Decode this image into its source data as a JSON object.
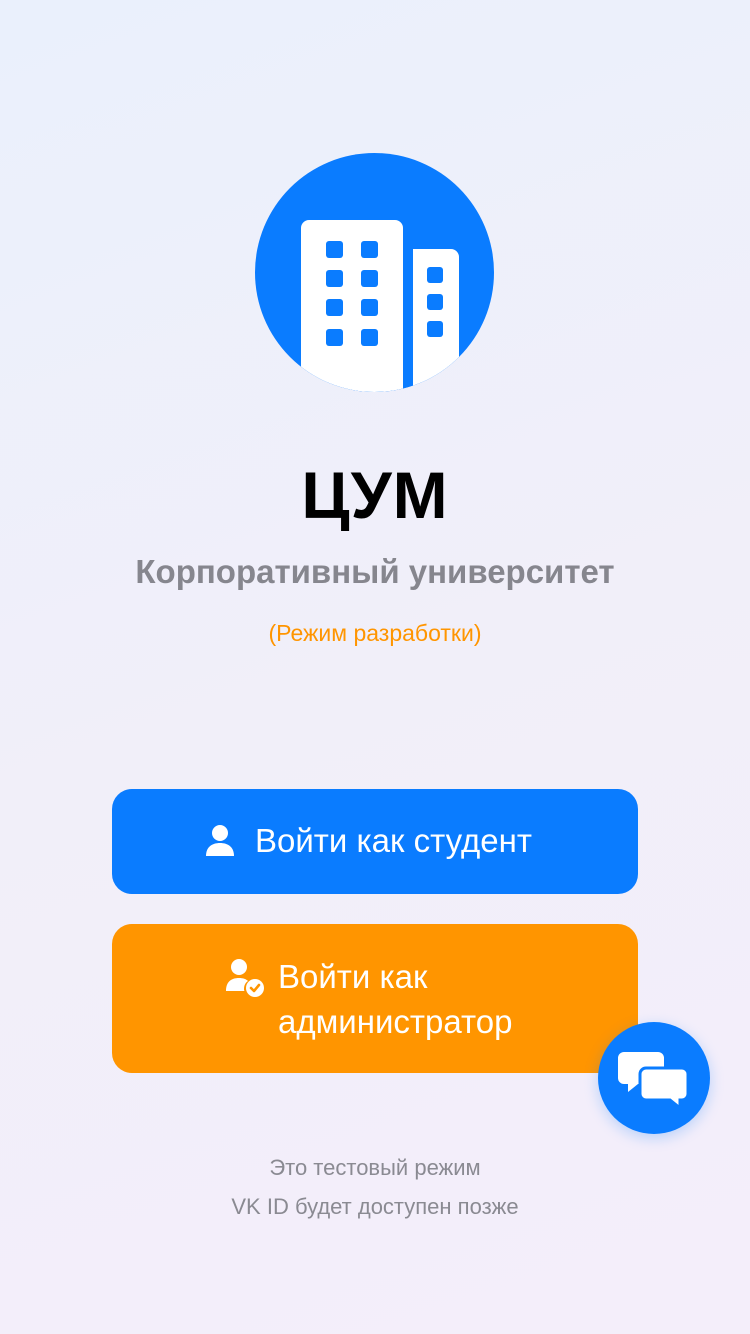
{
  "app": {
    "title": "ЦУМ",
    "subtitle": "Корпоративный университет",
    "mode_label": "(Режим разработки)"
  },
  "logo": {
    "icon": "buildings-icon",
    "color": "#0a7cff"
  },
  "buttons": {
    "student": {
      "label": "Войти как студент",
      "icon": "person-icon",
      "color": "#0a7cff"
    },
    "admin": {
      "label": "Войти как администратор",
      "icon": "person-checkmark-icon",
      "color": "#ff9500"
    }
  },
  "chat_button": {
    "icon": "chat-bubbles-icon",
    "color": "#0a7cff"
  },
  "footer": {
    "line1": "Это тестовый режим",
    "line2": "VK ID будет доступен позже"
  }
}
